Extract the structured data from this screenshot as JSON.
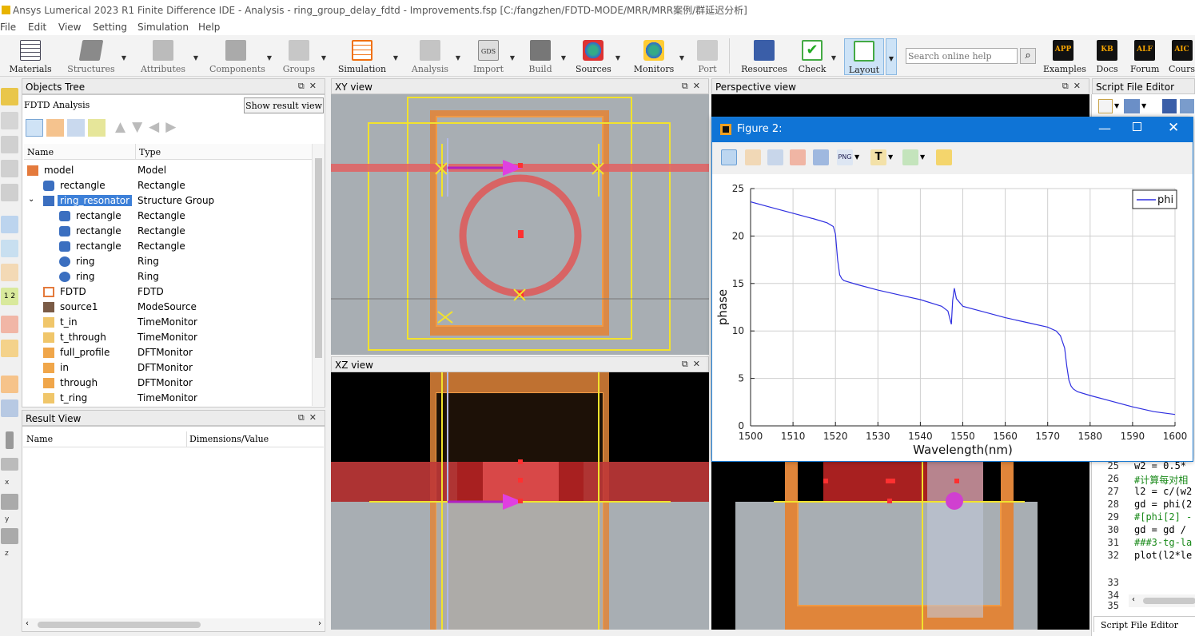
{
  "window": {
    "title": "Ansys Lumerical 2023 R1 Finite Difference IDE - Analysis - ring_group_delay_fdtd - Improvements.fsp [C:/fangzhen/FDTD-MODE/MRR/MRR案例/群延迟分析]"
  },
  "menu": [
    "File",
    "Edit",
    "View",
    "Setting",
    "Simulation",
    "Help"
  ],
  "toolbar": {
    "items": [
      "Materials",
      "Structures",
      "Attributes",
      "Components",
      "Groups",
      "Simulation",
      "Analysis",
      "Import",
      "Build",
      "Sources",
      "Monitors",
      "Port",
      "Resources",
      "Check",
      "Layout",
      "Examples",
      "Docs",
      "Forum",
      "Cours"
    ],
    "search_placeholder": "Search online help",
    "badges": {
      "examples": "APP",
      "docs": "KB",
      "forum": "ALF",
      "courses": "AIC"
    },
    "import_badge": "GDS"
  },
  "objects_tree": {
    "title": "Objects Tree",
    "mode": "FDTD Analysis",
    "show_result_view": "Show result view",
    "col_name": "Name",
    "col_type": "Type",
    "rows": [
      {
        "name": "model",
        "type": "Model"
      },
      {
        "name": "rectangle",
        "type": "Rectangle"
      },
      {
        "name": "ring_resonator",
        "type": "Structure Group"
      },
      {
        "name": "rectangle",
        "type": "Rectangle"
      },
      {
        "name": "rectangle",
        "type": "Rectangle"
      },
      {
        "name": "rectangle",
        "type": "Rectangle"
      },
      {
        "name": "ring",
        "type": "Ring"
      },
      {
        "name": "ring",
        "type": "Ring"
      },
      {
        "name": "FDTD",
        "type": "FDTD"
      },
      {
        "name": "source1",
        "type": "ModeSource"
      },
      {
        "name": "t_in",
        "type": "TimeMonitor"
      },
      {
        "name": "t_through",
        "type": "TimeMonitor"
      },
      {
        "name": "full_profile",
        "type": "DFTMonitor"
      },
      {
        "name": "in",
        "type": "DFTMonitor"
      },
      {
        "name": "through",
        "type": "DFTMonitor"
      },
      {
        "name": "t_ring",
        "type": "TimeMonitor"
      }
    ]
  },
  "result_view": {
    "title": "Result View",
    "col_name": "Name",
    "col_value": "Dimensions/Value"
  },
  "views": {
    "xy": "XY view",
    "xz": "XZ view",
    "perspective": "Perspective view"
  },
  "left_axis_labels": [
    "x",
    "y",
    "z"
  ],
  "left_scale_label": "1 2",
  "script_editor": {
    "title": "Script File Editor",
    "tab": "Script File Editor",
    "lines": [
      {
        "n": "25",
        "text": "w2 = 0.5*"
      },
      {
        "n": "26",
        "text": "#计算每对相"
      },
      {
        "n": "27",
        "text": "l2 = c/(w2"
      },
      {
        "n": "28",
        "text": "gd = phi(2"
      },
      {
        "n": "29",
        "text": "#[phi[2] -"
      },
      {
        "n": "30",
        "text": "gd = gd /"
      },
      {
        "n": "31",
        "text": "###3-tg-la"
      },
      {
        "n": "32",
        "text": "plot(l2*le"
      },
      {
        "n": "33",
        "text": ""
      },
      {
        "n": "34",
        "text": ""
      },
      {
        "n": "35",
        "text": ""
      }
    ]
  },
  "figure": {
    "title": "Figure 2:",
    "png_label": "PNG",
    "text_tool": "T"
  },
  "chart_data": {
    "type": "line",
    "xlabel": "Wavelength(nm)",
    "ylabel": "phase",
    "xlim": [
      1500,
      1600
    ],
    "ylim": [
      0,
      25
    ],
    "xticks": [
      1500,
      1510,
      1520,
      1530,
      1540,
      1550,
      1560,
      1570,
      1580,
      1590,
      1600
    ],
    "yticks": [
      0,
      5,
      10,
      15,
      20,
      25
    ],
    "grid": true,
    "legend": "top-right",
    "series": [
      {
        "name": "phi",
        "color": "#2f2fe0",
        "x": [
          1500,
          1505,
          1510,
          1515,
          1518,
          1519.5,
          1520,
          1520.5,
          1521,
          1521.5,
          1522,
          1525,
          1530,
          1535,
          1540,
          1545,
          1546.5,
          1547,
          1547.3,
          1547.6,
          1548,
          1548.5,
          1550,
          1555,
          1560,
          1565,
          1570,
          1572,
          1573,
          1574,
          1574.5,
          1575,
          1575.5,
          1576,
          1577,
          1580,
          1585,
          1590,
          1595,
          1600
        ],
        "y": [
          23.6,
          23.0,
          22.4,
          21.8,
          21.4,
          21.0,
          20.2,
          17.5,
          15.9,
          15.5,
          15.3,
          14.9,
          14.3,
          13.8,
          13.3,
          12.6,
          12.1,
          11.2,
          10.7,
          13.2,
          14.5,
          13.4,
          12.6,
          12.0,
          11.4,
          10.9,
          10.4,
          10.0,
          9.5,
          8.2,
          6.3,
          4.8,
          4.2,
          3.9,
          3.6,
          3.2,
          2.6,
          2.0,
          1.5,
          1.2
        ]
      }
    ]
  }
}
